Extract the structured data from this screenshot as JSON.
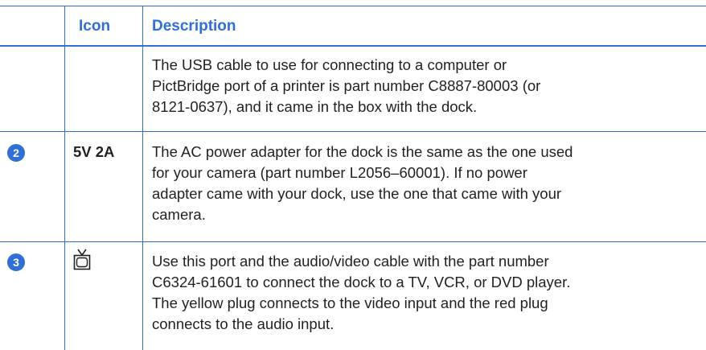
{
  "header": {
    "icon": "Icon",
    "description": "Description"
  },
  "rows": [
    {
      "number": "",
      "icon": "",
      "description": "The USB cable to use for connecting to a computer or PictBridge port of a printer is part number C8887-80003 (or 8121-0637), and it came in the box with the dock.",
      "lines": [
        "The USB cable to use for connecting to a computer or",
        "PictBridge port of a printer is part number C8887-80003 (or",
        "8121-0637), and it came in the box with the dock."
      ]
    },
    {
      "number": "2",
      "icon": "5V 2A",
      "lines": [
        "The AC power adapter for the dock is the same as the one used",
        "for your camera (part number L2056–60001). If no power",
        "adapter came with your dock, use the one that came with your",
        "camera."
      ]
    },
    {
      "number": "3",
      "icon": "tv-icon",
      "lines": [
        "Use this port and the audio/video cable with the part number",
        "C6324-61601 to connect the dock to a TV, VCR, or DVD player.",
        "The yellow plug connects to the video input and the red plug",
        "connects to the audio input."
      ]
    }
  ],
  "colors": {
    "accent": "#2f6fd6",
    "text": "#231f20"
  }
}
